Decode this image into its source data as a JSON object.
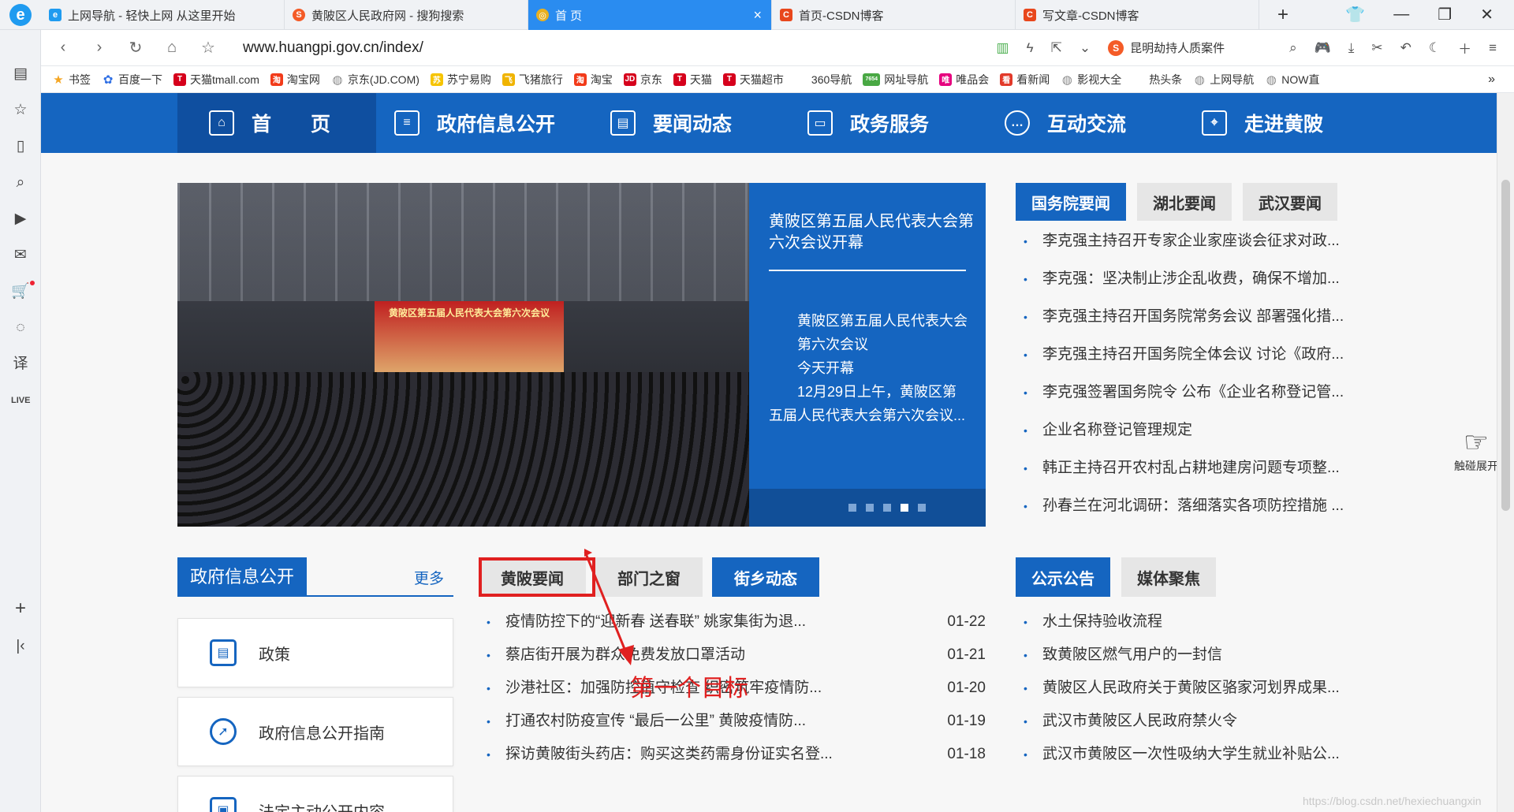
{
  "browser": {
    "logo": "e",
    "tabs": [
      {
        "label": "上网导航 - 轻快上网 从这里开始",
        "icon_letter": "e",
        "icon_color": "#1f9bf0"
      },
      {
        "label": "黄陂区人民政府网 - 搜狗搜索",
        "icon_letter": "S",
        "icon_color": "#f45b27"
      },
      {
        "label": "首 页",
        "icon_letter": "◎",
        "icon_color": "#e8b020",
        "active": true
      },
      {
        "label": "首页-CSDN博客",
        "icon_letter": "C",
        "icon_color": "#e8471c"
      },
      {
        "label": "写文章-CSDN博客",
        "icon_letter": "C",
        "icon_color": "#e8471c"
      }
    ],
    "url": "www.huangpi.gov.cn/index/",
    "search_hint": "昆明劫持人质案件",
    "bookmarks": [
      {
        "label": "书签",
        "icon": "star-icon",
        "color": "#f5a623"
      },
      {
        "label": "百度一下",
        "icon": "paw-icon",
        "color": "#2f6fe4"
      },
      {
        "label": "天猫tmall.com",
        "icon": "T",
        "color": "#d6001c"
      },
      {
        "label": "淘宝网",
        "icon": "淘",
        "color": "#f23b1a"
      },
      {
        "label": "京东(JD.COM)",
        "icon": "globe-icon",
        "color": "#888888"
      },
      {
        "label": "苏宁易购",
        "icon": "苏",
        "color": "#f6c400"
      },
      {
        "label": "飞猪旅行",
        "icon": "飞",
        "color": "#f0b400"
      },
      {
        "label": "淘宝",
        "icon": "淘",
        "color": "#f23b1a"
      },
      {
        "label": "京东",
        "icon": "JD",
        "color": "#d6001c"
      },
      {
        "label": "天猫",
        "icon": "T",
        "color": "#d6001c"
      },
      {
        "label": "天猫超市",
        "icon": "T",
        "color": "#d6001c"
      },
      {
        "label": "360导航",
        "icon": "",
        "color": "#2aa34a"
      },
      {
        "label": "网址导航",
        "icon": "7654",
        "color": "#49a844"
      },
      {
        "label": "唯品会",
        "icon": "唯",
        "color": "#e6007e"
      },
      {
        "label": "看新闻",
        "icon": "看",
        "color": "#e23a2a"
      },
      {
        "label": "影视大全",
        "icon": "globe-icon",
        "color": "#888888"
      },
      {
        "label": "热头条",
        "icon": "",
        "color": "#e23a2a"
      },
      {
        "label": "上网导航",
        "icon": "globe-icon",
        "color": "#888888"
      },
      {
        "label": "NOW直",
        "icon": "globe-icon",
        "color": "#888888"
      }
    ]
  },
  "nav": {
    "items": [
      {
        "label": "首　　页",
        "icon": "home-icon"
      },
      {
        "label": "政府信息公开",
        "icon": "document-icon"
      },
      {
        "label": "要闻动态",
        "icon": "news-icon"
      },
      {
        "label": "政务服务",
        "icon": "briefcase-icon"
      },
      {
        "label": "互动交流",
        "icon": "chat-icon"
      },
      {
        "label": "走进黄陂",
        "icon": "map-icon"
      }
    ]
  },
  "banner": {
    "stage_banner": "黄陂区第五届人民代表大会第六次会议",
    "title": "黄陂区第五届人民代表大会第六次会议开幕",
    "body": "黄陂区第五届人民代表大会第六次会议今天开幕 12月29日上午，黄陂区第五届人民代表大会第六次会议...",
    "body_lines": [
      "黄陂区第五届人民代表大会",
      "第六次会议",
      "今天开幕",
      "12月29日上午，黄陂区第",
      "五届人民代表大会第六次会议..."
    ],
    "dot_count": 5,
    "active_dot": 4
  },
  "news_right": {
    "tabs": [
      "国务院要闻",
      "湖北要闻",
      "武汉要闻"
    ],
    "items": [
      "李克强主持召开专家企业家座谈会征求对政...",
      "李克强：坚决制止涉企乱收费，确保不增加...",
      "李克强主持召开国务院常务会议 部署强化措...",
      "李克强主持召开国务院全体会议 讨论《政府...",
      "李克强签署国务院令 公布《企业名称登记管...",
      "企业名称登记管理规定",
      "韩正主持召开农村乱占耕地建房问题专项整...",
      "孙春兰在河北调研：落细落实各项防控措施 ..."
    ]
  },
  "gov_info": {
    "title": "政府信息公开",
    "more": "更多",
    "cards": [
      {
        "label": "政策",
        "icon": "policy-icon"
      },
      {
        "label": "政府信息公开指南",
        "icon": "compass-icon"
      },
      {
        "label": "法定主动公开内容",
        "icon": "clipboard-icon"
      }
    ]
  },
  "news_mid": {
    "tabs": [
      "黄陂要闻",
      "部门之窗",
      "街乡动态"
    ],
    "items": [
      {
        "title": "疫情防控下的“迎新春 送春联” 姚家集街为退...",
        "date": "01-22"
      },
      {
        "title": "蔡店街开展为群众免费发放口罩活动",
        "date": "01-21"
      },
      {
        "title": "沙港社区：加强防控值守检查 织密筑牢疫情防...",
        "date": "01-20"
      },
      {
        "title": "打通农村防疫宣传 “最后一公里” 黄陂疫情防...",
        "date": "01-19"
      },
      {
        "title": "探访黄陂街头药店：购买这类药需身份证实名登...",
        "date": "01-18"
      }
    ]
  },
  "notices": {
    "tabs": [
      "公示公告",
      "媒体聚焦"
    ],
    "items": [
      "水土保持验收流程",
      "致黄陂区燃气用户的一封信",
      "黄陂区人民政府关于黄陂区骆家河划界成果...",
      "武汉市黄陂区人民政府禁火令",
      "武汉市黄陂区一次性吸纳大学生就业补贴公..."
    ]
  },
  "annotation": {
    "text": "第一个目标",
    "color": "#e02020"
  },
  "touch_hint": "触碰展开",
  "watermark": "https://blog.csdn.net/hexiechuangxin",
  "colors": {
    "primary": "#1565c0",
    "primary_dark": "#0f4fa0",
    "tab_active": "#2a8cf0"
  }
}
